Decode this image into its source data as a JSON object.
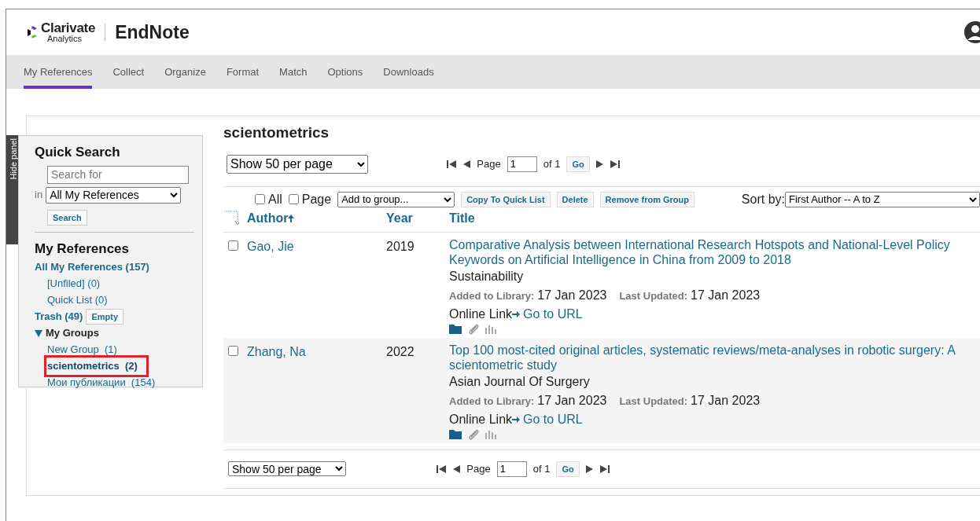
{
  "brand": {
    "company": "Clarivate",
    "company_sub": "Analytics",
    "product": "EndNote"
  },
  "nav": [
    {
      "label": "My References",
      "selected": true
    },
    {
      "label": "Collect",
      "selected": false
    },
    {
      "label": "Organize",
      "selected": false
    },
    {
      "label": "Format",
      "selected": false
    },
    {
      "label": "Match",
      "selected": false
    },
    {
      "label": "Options",
      "selected": false
    },
    {
      "label": "Downloads",
      "selected": false
    }
  ],
  "hide_panel": "Hide panel",
  "quick_search": {
    "title": "Quick Search",
    "placeholder": "Search for",
    "in_label": "in",
    "scope": "All My References",
    "button": "Search"
  },
  "library": {
    "title": "My References",
    "items": [
      {
        "label": "All My References (157)",
        "kind": "top"
      },
      {
        "label": "[Unfiled] (0)",
        "kind": "sub"
      },
      {
        "label": "Quick List (0)",
        "kind": "sub"
      },
      {
        "label": "Trash (49)",
        "kind": "trash",
        "action": "Empty"
      }
    ],
    "groups": {
      "label": "My Groups",
      "expanded": true,
      "children": [
        {
          "label": "New Group  (1)",
          "selected": false
        },
        {
          "label": "scientometrics  (2)",
          "selected": true
        },
        {
          "label": "Мои публикации  (154)",
          "selected": false
        }
      ]
    }
  },
  "main": {
    "title": "scientometrics",
    "per_page": "Show 50 per page",
    "pager": {
      "page_label": "Page",
      "page": "1",
      "of": "of 1",
      "go": "Go"
    },
    "toolbar": {
      "all": {
        "label": "All",
        "checked": false
      },
      "page": {
        "label": "Page",
        "checked": false
      },
      "add_to_group": "Add to group...",
      "buttons": [
        "Copy To Quick List",
        "Delete",
        "Remove from Group"
      ],
      "sort_label": "Sort by:",
      "sort": "First Author -- A to Z"
    },
    "columns": [
      "Author",
      "Year",
      "Title"
    ],
    "rows": [
      {
        "checked": false,
        "author": "Gao, Jie",
        "year": "2019",
        "title": "Comparative Analysis between International Research Hotspots and National-Level Policy Keywords on Artificial Intelligence in China from 2009 to 2018",
        "journal": "Sustainability",
        "added_label": "Added to Library:",
        "added": "17 Jan 2023",
        "updated_label": "Last Updated:",
        "updated": "17 Jan 2023",
        "link_label": "Online Link",
        "link": "Go to URL"
      },
      {
        "checked": false,
        "author": "Zhang, Na",
        "year": "2022",
        "title": "Top 100 most-cited original articles, systematic reviews/meta-analyses in robotic surgery: A scientometric study",
        "journal": "Asian Journal Of Surgery",
        "added_label": "Added to Library:",
        "added": "17 Jan 2023",
        "updated_label": "Last Updated:",
        "updated": "17 Jan 2023",
        "link_label": "Online Link",
        "link": "Go to URL"
      }
    ],
    "footer": {
      "per_page": "Show 50 per page",
      "pager": {
        "page_label": "Page",
        "page": "1",
        "of": "of 1",
        "go": "Go"
      }
    }
  }
}
